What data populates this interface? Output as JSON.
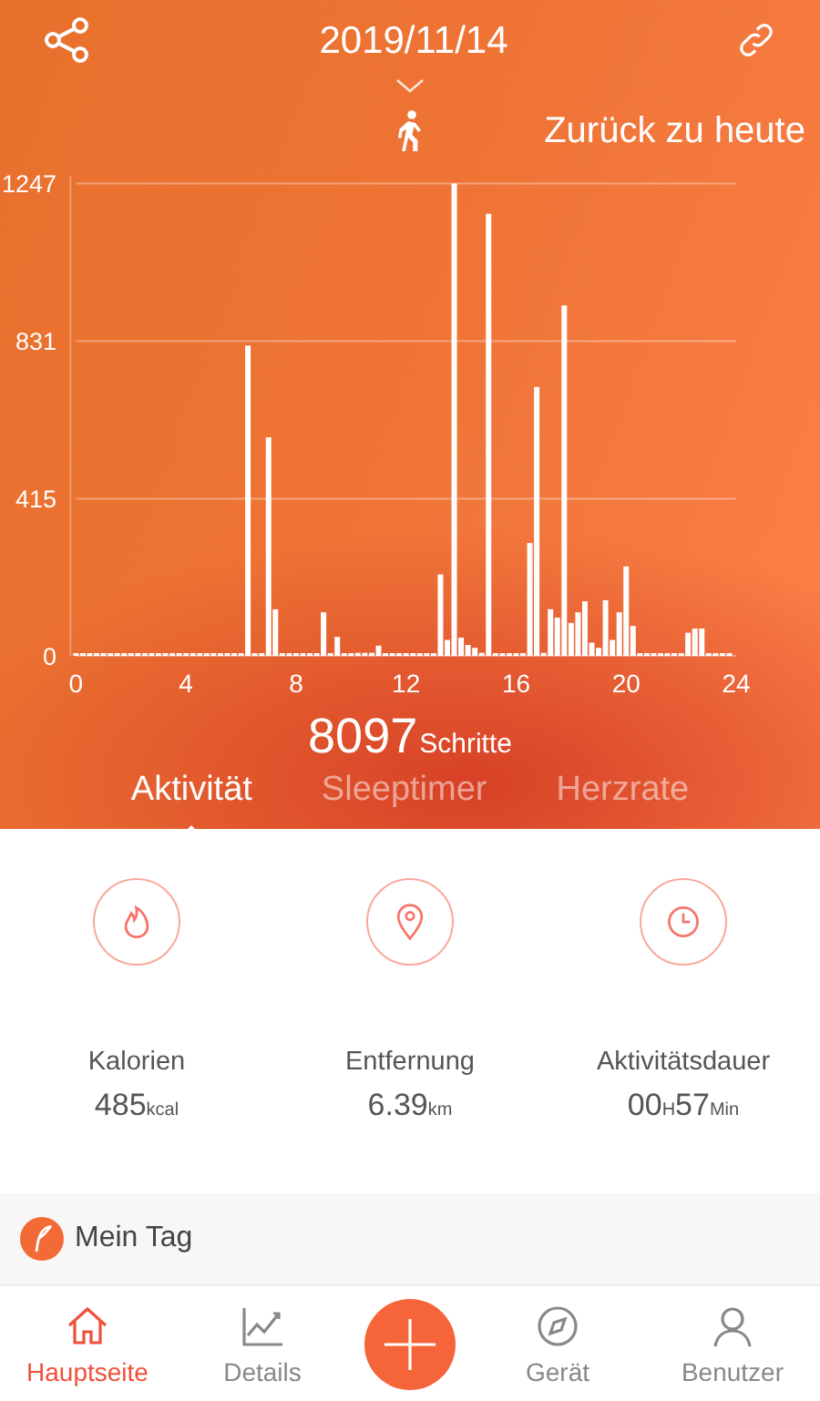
{
  "header": {
    "date": "2019/11/14",
    "back_to_today": "Zurück zu heute"
  },
  "chart_data": {
    "type": "bar",
    "xlim": [
      0,
      24
    ],
    "ylim": [
      0,
      1247
    ],
    "xticks": [
      0,
      4,
      8,
      12,
      16,
      20,
      24
    ],
    "yticks": [
      0,
      415,
      831,
      1247
    ],
    "x": [
      0,
      0.25,
      0.5,
      0.75,
      1,
      1.25,
      1.5,
      1.75,
      2,
      2.25,
      2.5,
      2.75,
      3,
      3.25,
      3.5,
      3.75,
      4,
      4.25,
      4.5,
      4.75,
      5,
      5.25,
      5.5,
      5.75,
      6,
      6.25,
      6.5,
      6.75,
      7,
      7.25,
      7.5,
      7.75,
      8,
      8.25,
      8.5,
      8.75,
      9,
      9.25,
      9.5,
      9.75,
      10,
      10.25,
      10.5,
      10.75,
      11,
      11.25,
      11.5,
      11.75,
      12,
      12.25,
      12.5,
      12.75,
      13,
      13.25,
      13.5,
      13.75,
      14,
      14.25,
      14.5,
      14.75,
      15,
      15.25,
      15.5,
      15.75,
      16,
      16.25,
      16.5,
      16.75,
      17,
      17.25,
      17.5,
      17.75,
      18,
      18.25,
      18.5,
      18.75,
      19,
      19.25,
      19.5,
      19.75,
      20,
      20.25,
      20.5,
      20.75,
      21,
      21.25,
      21.5,
      21.75,
      22,
      22.25,
      22.5,
      22.75,
      23,
      23.25,
      23.5,
      23.75
    ],
    "values": [
      0,
      0,
      0,
      0,
      0,
      0,
      0,
      0,
      0,
      0,
      0,
      0,
      0,
      0,
      0,
      0,
      0,
      0,
      0,
      0,
      0,
      0,
      0,
      0,
      0,
      819,
      0,
      0,
      577,
      123,
      0,
      0,
      0,
      0,
      0,
      0,
      115,
      0,
      50,
      0,
      0,
      8,
      8,
      8,
      27,
      0,
      0,
      0,
      0,
      0,
      0,
      0,
      0,
      215,
      42,
      1247,
      48,
      29,
      21,
      8,
      1167,
      0,
      0,
      0,
      0,
      0,
      298,
      710,
      8,
      123,
      101,
      925,
      87,
      115,
      144,
      35,
      21,
      147,
      42,
      115,
      236,
      79,
      0,
      0,
      0,
      0,
      0,
      0,
      0,
      61,
      72,
      72,
      0,
      0,
      0,
      0
    ]
  },
  "steps": {
    "value": "8097",
    "unit": "Schritte"
  },
  "tabs": [
    {
      "label": "Aktivität",
      "selected": true
    },
    {
      "label": "Sleeptimer",
      "selected": false
    },
    {
      "label": "Herzrate",
      "selected": false
    }
  ],
  "stats": [
    {
      "kind": "calories",
      "label": "Kalorien",
      "parts": [
        {
          "kind": "number",
          "text": "485"
        },
        {
          "kind": "unit",
          "text": "kcal"
        }
      ]
    },
    {
      "kind": "distance",
      "label": "Entfernung",
      "parts": [
        {
          "kind": "number",
          "text": "6.39"
        },
        {
          "kind": "unit",
          "text": "km"
        }
      ]
    },
    {
      "kind": "duration",
      "label": "Aktivitätsdauer",
      "parts": [
        {
          "kind": "number",
          "text": "00"
        },
        {
          "kind": "unit",
          "text": "H"
        },
        {
          "kind": "number",
          "text": "57"
        },
        {
          "kind": "unit",
          "text": "Min"
        }
      ]
    }
  ],
  "my_day": {
    "label": "Mein Tag"
  },
  "nav": [
    {
      "kind": "home",
      "label": "Hauptseite",
      "selected": true
    },
    {
      "kind": "chart",
      "label": "Details",
      "selected": false
    },
    {
      "kind": "add"
    },
    {
      "kind": "compass",
      "label": "Gerät",
      "selected": false
    },
    {
      "kind": "user",
      "label": "Benutzer",
      "selected": false
    }
  ]
}
